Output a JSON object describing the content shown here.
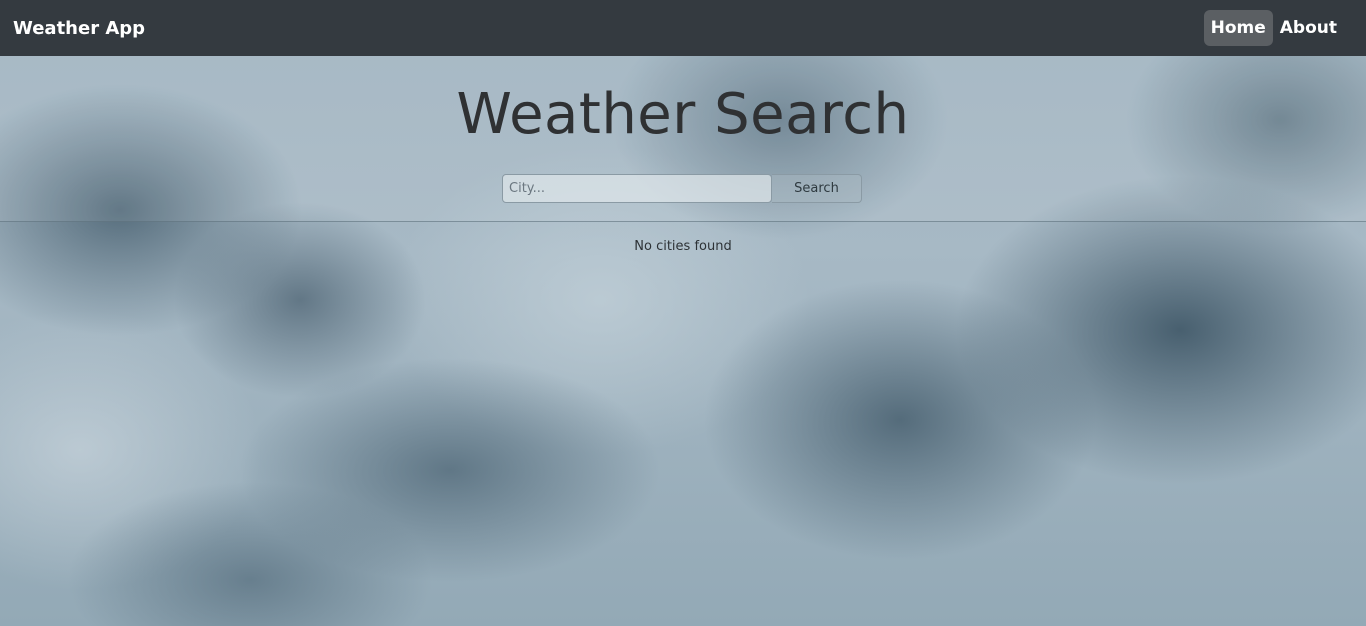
{
  "navbar": {
    "brand": "Weather App",
    "links": [
      {
        "label": "Home",
        "active": true
      },
      {
        "label": "About",
        "active": false
      }
    ]
  },
  "main": {
    "title": "Weather Search",
    "search": {
      "placeholder": "City...",
      "value": "",
      "button_label": "Search"
    },
    "results_message": "No cities found"
  },
  "colors": {
    "navbar_bg": "#343a40",
    "active_link_bg": "#5b5f63",
    "title_text": "#2f3133"
  },
  "background": "cloudy-sky-image"
}
